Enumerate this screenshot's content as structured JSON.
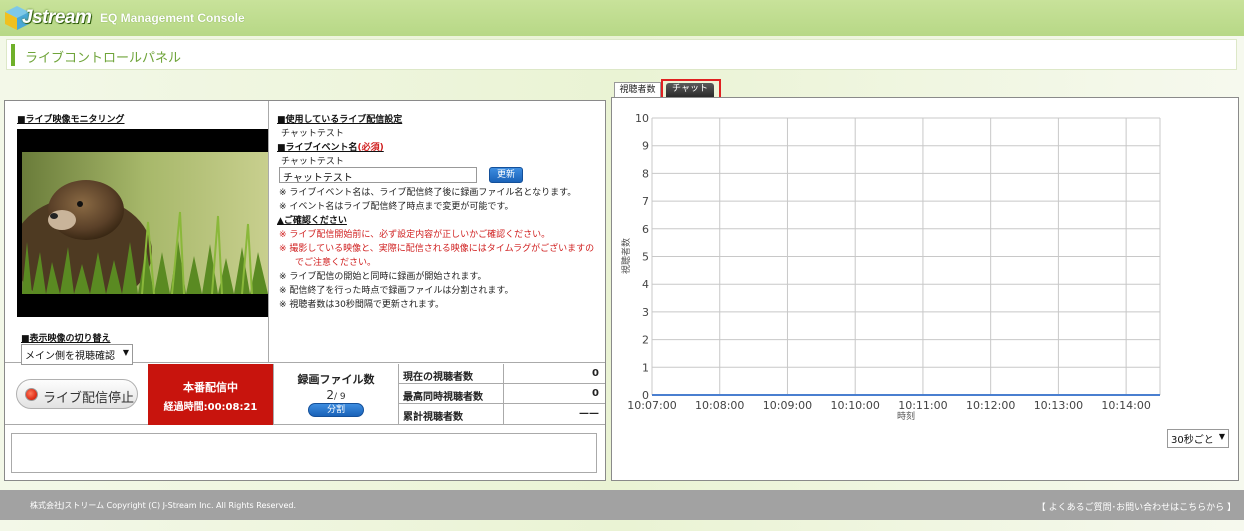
{
  "header": {
    "logo_text": "Jstream",
    "console_title": "EQ Management Console"
  },
  "page": {
    "title": "ライブコントロールパネル"
  },
  "monitor": {
    "title": "■ライブ映像モニタリング",
    "switch_title": "■表示映像の切り替え",
    "switch_selected": "メイン側を視聴確認"
  },
  "settings": {
    "config_title": "■使用しているライブ配信設定",
    "config_value": "チャットテスト",
    "event_title": "■ライブイベント名",
    "event_required": "(必須)",
    "event_current": "チャットテスト",
    "event_input_value": "チャットテスト",
    "update_button": "更新",
    "notes": [
      "※ ライブイベント名は、ライブ配信終了後に録画ファイル名となります。",
      "※ イベント名はライブ配信終了時点まで変更が可能です。"
    ],
    "confirm_title": "▲ご確認ください",
    "warnings": [
      "※ ライブ配信開始前に、必ず設定内容が正しいかご確認ください。",
      "※ 撮影している映像と、実際に配信される映像にはタイムラグがございますの",
      "でご注意ください。"
    ],
    "info": [
      "※ ライブ配信の開始と同時に録画が開始されます。",
      "※ 配信終了を行った時点で録画ファイルは分割されます。",
      "※ 視聴者数は30秒間隔で更新されます。"
    ]
  },
  "status": {
    "stop_button": "ライブ配信停止",
    "live_label": "本番配信中",
    "elapsed_label": "経過時間:00:08:21",
    "rec_title": "録画ファイル数",
    "rec_current": "2",
    "rec_total": "/ 9",
    "split_button": "分割",
    "viewers": [
      {
        "label": "現在の視聴者数",
        "value": "0"
      },
      {
        "label": "最高同時視聴者数",
        "value": "0"
      },
      {
        "label": "累計視聴者数",
        "value": "——"
      }
    ]
  },
  "tabs": {
    "viewers": "視聴者数",
    "chat": "チャット"
  },
  "chart_data": {
    "type": "line",
    "x": [
      "10:07:00",
      "10:08:00",
      "10:09:00",
      "10:10:00",
      "10:11:00",
      "10:12:00",
      "10:13:00",
      "10:14:00"
    ],
    "series": [
      {
        "values": [
          0,
          0,
          0,
          0,
          0,
          0,
          0,
          0,
          0
        ]
      }
    ],
    "yticks": [
      "0",
      "1",
      "2",
      "3",
      "4",
      "5",
      "6",
      "7",
      "8",
      "9",
      "10"
    ],
    "ylim": [
      0,
      10
    ],
    "xlabel": "時刻",
    "ylabel": "視聴者数",
    "grid": true,
    "line_color": "#4a7fd0"
  },
  "interval_select": "30秒ごと",
  "footer": {
    "copyright": "株式会社Jストリーム  Copyright (C) J-Stream Inc. All Rights Reserved.",
    "faq_link": "【 よくあるご質問･お問い合わせはこちらから 】"
  }
}
